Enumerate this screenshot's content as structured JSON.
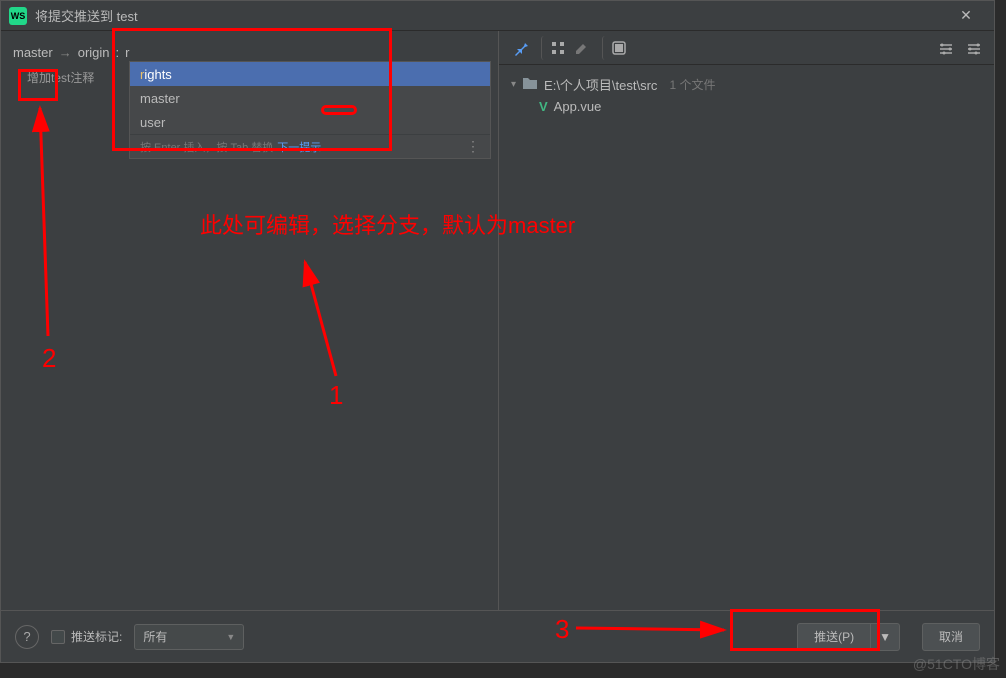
{
  "titlebar": {
    "title": "将提交推送到 test"
  },
  "left": {
    "local_branch": "master",
    "remote_label": "origin",
    "branch_input_value": "r",
    "commit_message": "增加test注释"
  },
  "dropdown": {
    "items": [
      {
        "prefix": "r",
        "rest": "ights"
      },
      {
        "prefix": "",
        "rest": "master"
      },
      {
        "prefix": "",
        "rest": "user"
      }
    ],
    "footer_hint": "按 Enter 插入，按 Tab 替换",
    "footer_link": "下一提示"
  },
  "right": {
    "path": "E:\\个人项目\\test\\src",
    "file_count": "1 个文件",
    "files": [
      {
        "name": "App.vue",
        "icon": "vue"
      }
    ]
  },
  "bottom": {
    "push_tags_label": "推送标记:",
    "select_value": "所有",
    "push_button": "推送(P)",
    "cancel_button": "取消"
  },
  "annotations": {
    "main_text": "此处可编辑，选择分支，默认为master",
    "num1": "1",
    "num2": "2",
    "num3": "3"
  },
  "watermark": "@51CTO博客"
}
